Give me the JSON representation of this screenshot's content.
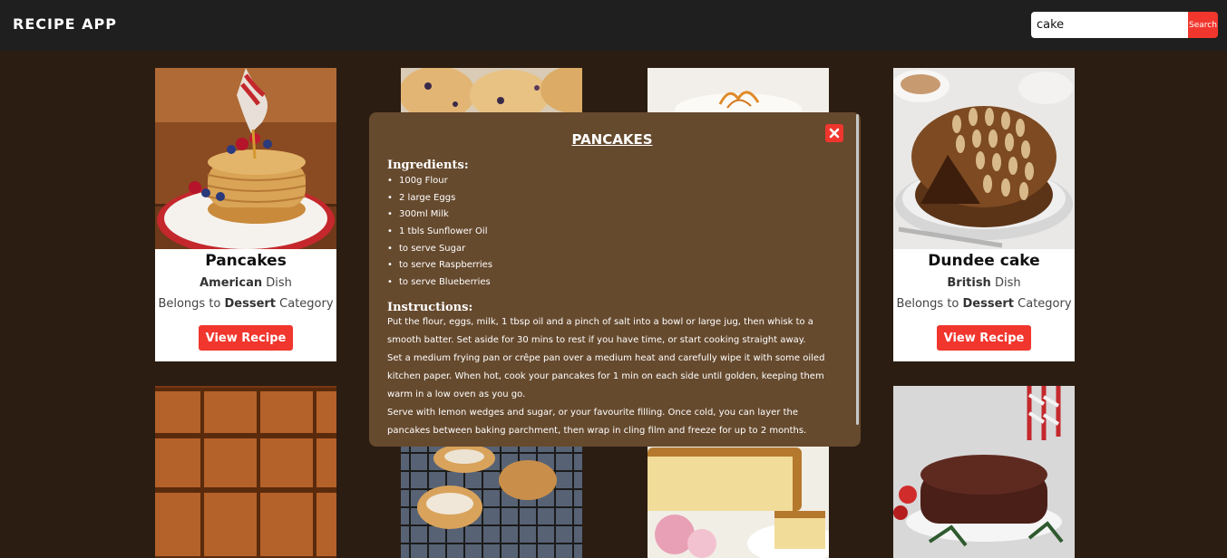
{
  "header": {
    "title": "RECIPE APP",
    "search": {
      "value": "cake",
      "placeholder": "",
      "button_label": "Search"
    }
  },
  "cards": [
    {
      "name": "Pancakes",
      "area": "American",
      "area_suffix": " Dish",
      "category_prefix": "Belongs to ",
      "category": "Dessert",
      "category_suffix": " Category",
      "button_label": "View Recipe"
    },
    {
      "name": "Dundee cake",
      "area": "British",
      "area_suffix": " Dish",
      "category_prefix": "Belongs to ",
      "category": "Dessert",
      "category_suffix": " Category",
      "button_label": "View Recipe"
    }
  ],
  "modal": {
    "title": "PANCAKES",
    "ingredients_heading": "Ingredients:",
    "ingredients": [
      "100g Flour",
      "2 large Eggs",
      "300ml Milk",
      "1 tbls Sunflower Oil",
      "to serve Sugar",
      "to serve Raspberries",
      "to serve Blueberries"
    ],
    "instructions_heading": "Instructions:",
    "instructions": [
      "Put the flour, eggs, milk, 1 tbsp oil and a pinch of salt into a bowl or large jug, then whisk to a smooth batter. Set aside for 30 mins to rest if you have time, or start cooking straight away.",
      "Set a medium frying pan or crêpe pan over a medium heat and carefully wipe it with some oiled kitchen paper. When hot, cook your pancakes for 1 min on each side until golden, keeping them warm in a low oven as you go.",
      "Serve with lemon wedges and sugar, or your favourite filling. Once cold, you can layer the pancakes between baking parchment, then wrap in cling film and freeze for up to 2 months."
    ]
  }
}
